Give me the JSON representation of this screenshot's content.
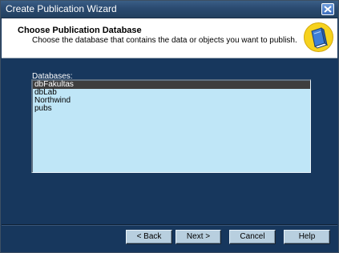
{
  "window": {
    "title": "Create Publication Wizard"
  },
  "header": {
    "title": "Choose Publication Database",
    "subtitle": "Choose the database that contains the data or objects you want to publish."
  },
  "databases": {
    "label": "Databases:",
    "items": [
      "dbFakultas",
      "dbLab",
      "Northwind",
      "pubs"
    ],
    "selected": "dbFakultas"
  },
  "buttons": {
    "back": "< Back",
    "next": "Next >",
    "cancel": "Cancel",
    "help": "Help"
  },
  "icons": {
    "close": "close-icon",
    "wizard": "publication-book-icon"
  },
  "colors": {
    "dialog_background": "#17375d",
    "list_background": "#bfe6f7",
    "selection": "#3e3e3e",
    "button_face": "#b8cfdf",
    "icon_circle": "#f6d21e"
  }
}
